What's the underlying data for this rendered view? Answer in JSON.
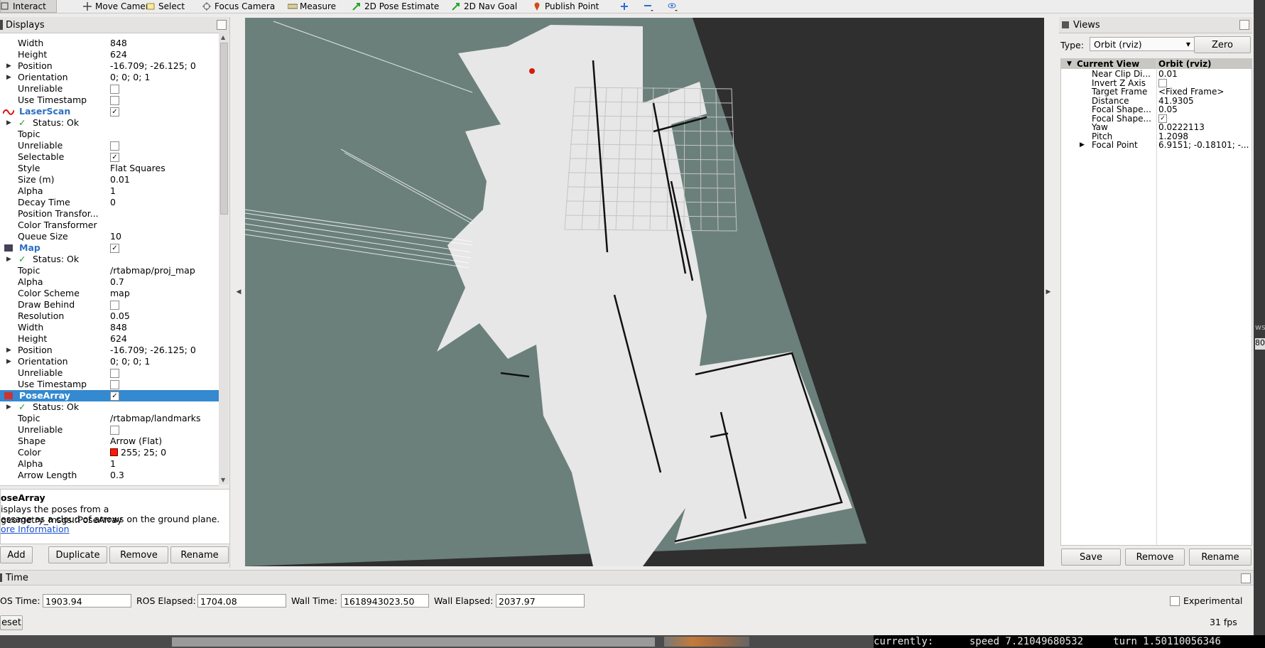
{
  "toolbar": {
    "tools": [
      "Interact",
      "Move Camera",
      "Select",
      "Focus Camera",
      "Measure",
      "2D Pose Estimate",
      "2D Nav Goal",
      "Publish Point"
    ]
  },
  "displays": {
    "title": "Displays",
    "rows": [
      {
        "name": "Width",
        "value": "848"
      },
      {
        "name": "Height",
        "value": "624"
      },
      {
        "name": "Position",
        "value": "-16.709; -26.125; 0"
      },
      {
        "name": "Orientation",
        "value": "0; 0; 0; 1"
      },
      {
        "name": "Unreliable",
        "value": ""
      },
      {
        "name": "Use Timestamp",
        "value": ""
      },
      {
        "name": "LaserScan",
        "value": "✓"
      },
      {
        "name": "Status: Ok",
        "value": ""
      },
      {
        "name": "Topic",
        "value": ""
      },
      {
        "name": "Unreliable",
        "value": ""
      },
      {
        "name": "Selectable",
        "value": "✓"
      },
      {
        "name": "Style",
        "value": "Flat Squares"
      },
      {
        "name": "Size (m)",
        "value": "0.01"
      },
      {
        "name": "Alpha",
        "value": "1"
      },
      {
        "name": "Decay Time",
        "value": "0"
      },
      {
        "name": "Position Transfor...",
        "value": ""
      },
      {
        "name": "Color Transformer",
        "value": ""
      },
      {
        "name": "Queue Size",
        "value": "10"
      },
      {
        "name": "Map",
        "value": "✓"
      },
      {
        "name": "Status: Ok",
        "value": ""
      },
      {
        "name": "Topic",
        "value": "/rtabmap/proj_map"
      },
      {
        "name": "Alpha",
        "value": "0.7"
      },
      {
        "name": "Color Scheme",
        "value": "map"
      },
      {
        "name": "Draw Behind",
        "value": ""
      },
      {
        "name": "Resolution",
        "value": "0.05"
      },
      {
        "name": "Width",
        "value": "848"
      },
      {
        "name": "Height",
        "value": "624"
      },
      {
        "name": "Position",
        "value": "-16.709; -26.125; 0"
      },
      {
        "name": "Orientation",
        "value": "0; 0; 0; 1"
      },
      {
        "name": "Unreliable",
        "value": ""
      },
      {
        "name": "Use Timestamp",
        "value": ""
      },
      {
        "name": "PoseArray",
        "value": "✓"
      },
      {
        "name": "Status: Ok",
        "value": ""
      },
      {
        "name": "Topic",
        "value": "/rtabmap/landmarks"
      },
      {
        "name": "Unreliable",
        "value": ""
      },
      {
        "name": "Shape",
        "value": "Arrow (Flat)"
      },
      {
        "name": "Color",
        "value": "255; 25; 0"
      },
      {
        "name": "Alpha",
        "value": "1"
      },
      {
        "name": "Arrow Length",
        "value": "0.3"
      }
    ],
    "help_title": "oseArray",
    "help_line1": "isplays the poses from a geometry_msgs::PoseArray",
    "help_line2": "essage as a cloud of arrows on the ground plane.",
    "help_link": "ore Information",
    "buttons": {
      "add": "Add",
      "duplicate": "Duplicate",
      "remove": "Remove",
      "rename": "Rename"
    }
  },
  "views": {
    "title": "Views",
    "type_label": "Type:",
    "type_value": "Orbit (rviz)",
    "zero": "Zero",
    "header_name": "Current View",
    "header_value": "Orbit (rviz)",
    "rows": [
      {
        "name": "Near Clip Di...",
        "value": "0.01"
      },
      {
        "name": "Invert Z Axis",
        "value": ""
      },
      {
        "name": "Target Frame",
        "value": "<Fixed Frame>"
      },
      {
        "name": "Distance",
        "value": "41.9305"
      },
      {
        "name": "Focal Shape...",
        "value": "0.05"
      },
      {
        "name": "Focal Shape...",
        "value": "✓"
      },
      {
        "name": "Yaw",
        "value": "0.0222113"
      },
      {
        "name": "Pitch",
        "value": "1.2098"
      },
      {
        "name": "Focal Point",
        "value": "6.9151; -0.18101; -..."
      }
    ],
    "buttons": {
      "save": "Save",
      "remove": "Remove",
      "rename": "Rename"
    }
  },
  "time": {
    "title": "Time",
    "ros_time_label": "OS Time:",
    "ros_time": "1903.94",
    "ros_elapsed_label": "ROS Elapsed:",
    "ros_elapsed": "1704.08",
    "wall_time_label": "Wall Time:",
    "wall_time": "1618943023.50",
    "wall_elapsed_label": "Wall Elapsed:",
    "wall_elapsed": "2037.97",
    "experimental": "Experimental",
    "reset": "eset",
    "fps": "31 fps"
  },
  "terminal": {
    "text": "currently:\tspeed 7.21049680532\tturn 1.50110056346"
  },
  "edge": {
    "label1": "ws",
    "label2": "80"
  }
}
